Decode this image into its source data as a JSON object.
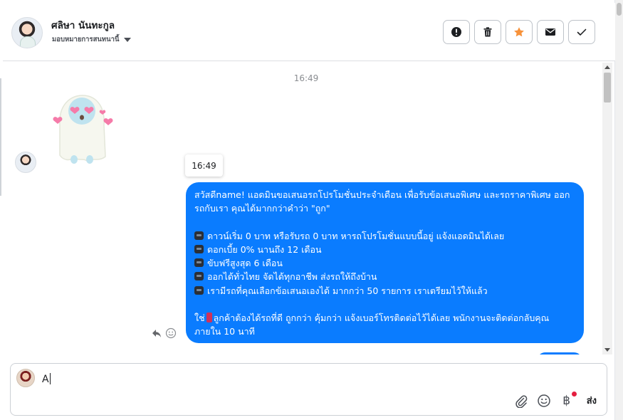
{
  "header": {
    "contact_name": "ศลิษา นันทะกูล",
    "assign_label": "มอบหมายการสนทนานี้",
    "actions": [
      {
        "name": "spam-button",
        "icon": "alert-circle-icon"
      },
      {
        "name": "delete-button",
        "icon": "trash-icon"
      },
      {
        "name": "star-button",
        "icon": "star-icon"
      },
      {
        "name": "mark-unread-button",
        "icon": "envelope-icon"
      },
      {
        "name": "done-button",
        "icon": "checkmark-icon"
      }
    ]
  },
  "conversation": {
    "timestamp_top": "16:49",
    "tooltip_time": "16:49",
    "message": {
      "greeting": "สวัสดีname! แอดมินขอเสนอรถโปรโมชั่นประจำเดือน เพื่อรับข้อเสนอพิเศษ และรถราคาพิเศษ ออกรถกับเรา คุณได้มากกว่าคำว่า \"ถูก\"",
      "bullets": [
        "ดาวน์เริ่ม 0 บาท หรือรับรถ 0 บาท หารถโปรโมชั่นแบบนี้อยู่ แจ้งแอดมินได้เลย",
        "ดอกเบี้ย 0% นานถึง 12 เดือน",
        "ขับฟรีสูงสุด 6 เดือน",
        "ออกได้ทั่วไทย จัดได้ทุกอาชีพ ส่งรถให้ถึงบ้าน",
        "เรามีรถที่คุณเลือกข้อเสนอเองได้ มากกว่า 50 รายการ เราเตรียมไว้ให้แล้ว"
      ],
      "closing_prefix": "ใช่",
      "closing_text": "ลูกค้าต้องได้รถที่ดี ถูกกว่า คุ้มกว่า แจ้งเบอร์โทรติดต่อไว้ได้เลย พนักงานจะติดต่อกลับคุณภายใน 10 นาที"
    }
  },
  "composer": {
    "input_value": "A",
    "send_label": "ส่ง",
    "currency_symbol": "฿"
  },
  "colors": {
    "bubble": "#0a7cff",
    "star": "#f7923a",
    "notification_dot": "#e41e3f"
  }
}
